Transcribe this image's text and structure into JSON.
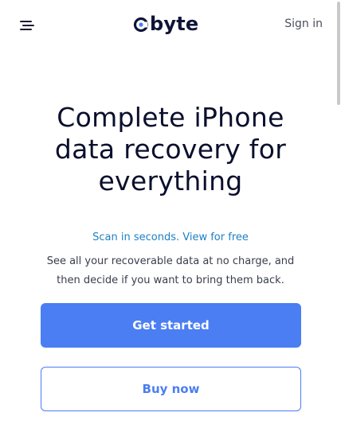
{
  "header": {
    "logo_text": "byte",
    "signin_label": "Sign in",
    "menu_icon": "hamburger-icon",
    "logo_icon": "cbyte-logo-mark"
  },
  "hero": {
    "title_line1": "Complete iPhone",
    "title_line2": "data recovery for",
    "title_line3": "everything",
    "tagline": "Scan in seconds. View for free",
    "desc_line1": "See all your recoverable data at no charge, and",
    "desc_line2": "then decide if you want to bring them back."
  },
  "actions": {
    "primary_label": "Get started",
    "secondary_label": "Buy now"
  },
  "colors": {
    "brand_navy": "#0f1437",
    "accent_blue": "#4a7ef2",
    "tagline_blue": "#1e7fc4"
  }
}
